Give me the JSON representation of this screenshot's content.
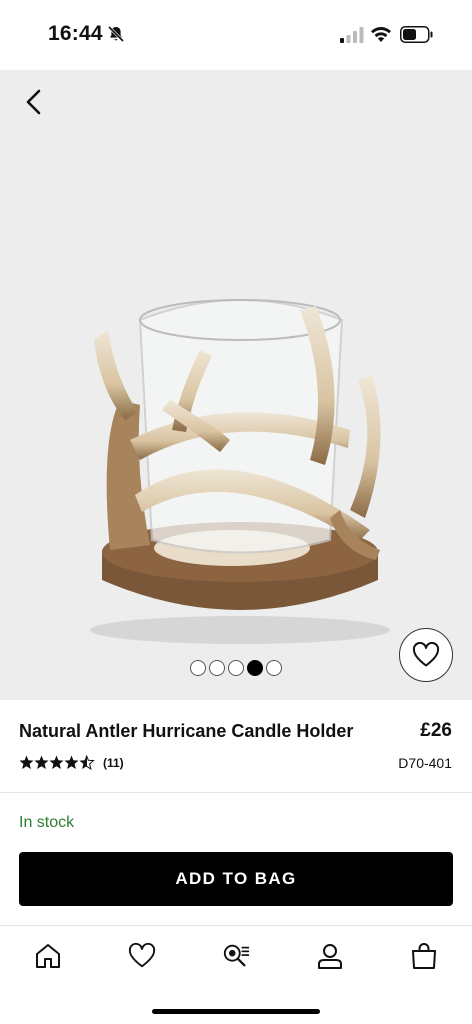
{
  "status_bar": {
    "time": "16:44"
  },
  "product": {
    "title": "Natural Antler Hurricane Candle Holder",
    "price": "£26",
    "rating": 4.5,
    "review_count": "(11)",
    "sku": "D70-401",
    "stock_status": "In stock"
  },
  "gallery": {
    "image_count": 5,
    "active_index": 3
  },
  "actions": {
    "add_to_bag_label": "ADD TO BAG"
  },
  "tab_bar": {
    "items": [
      {
        "icon": "home-icon"
      },
      {
        "icon": "heart-icon"
      },
      {
        "icon": "search-icon"
      },
      {
        "icon": "account-icon"
      },
      {
        "icon": "bag-icon"
      }
    ]
  },
  "colors": {
    "stock_green": "#2f7d32",
    "button_black": "#000000",
    "gallery_bg": "#ededed"
  }
}
